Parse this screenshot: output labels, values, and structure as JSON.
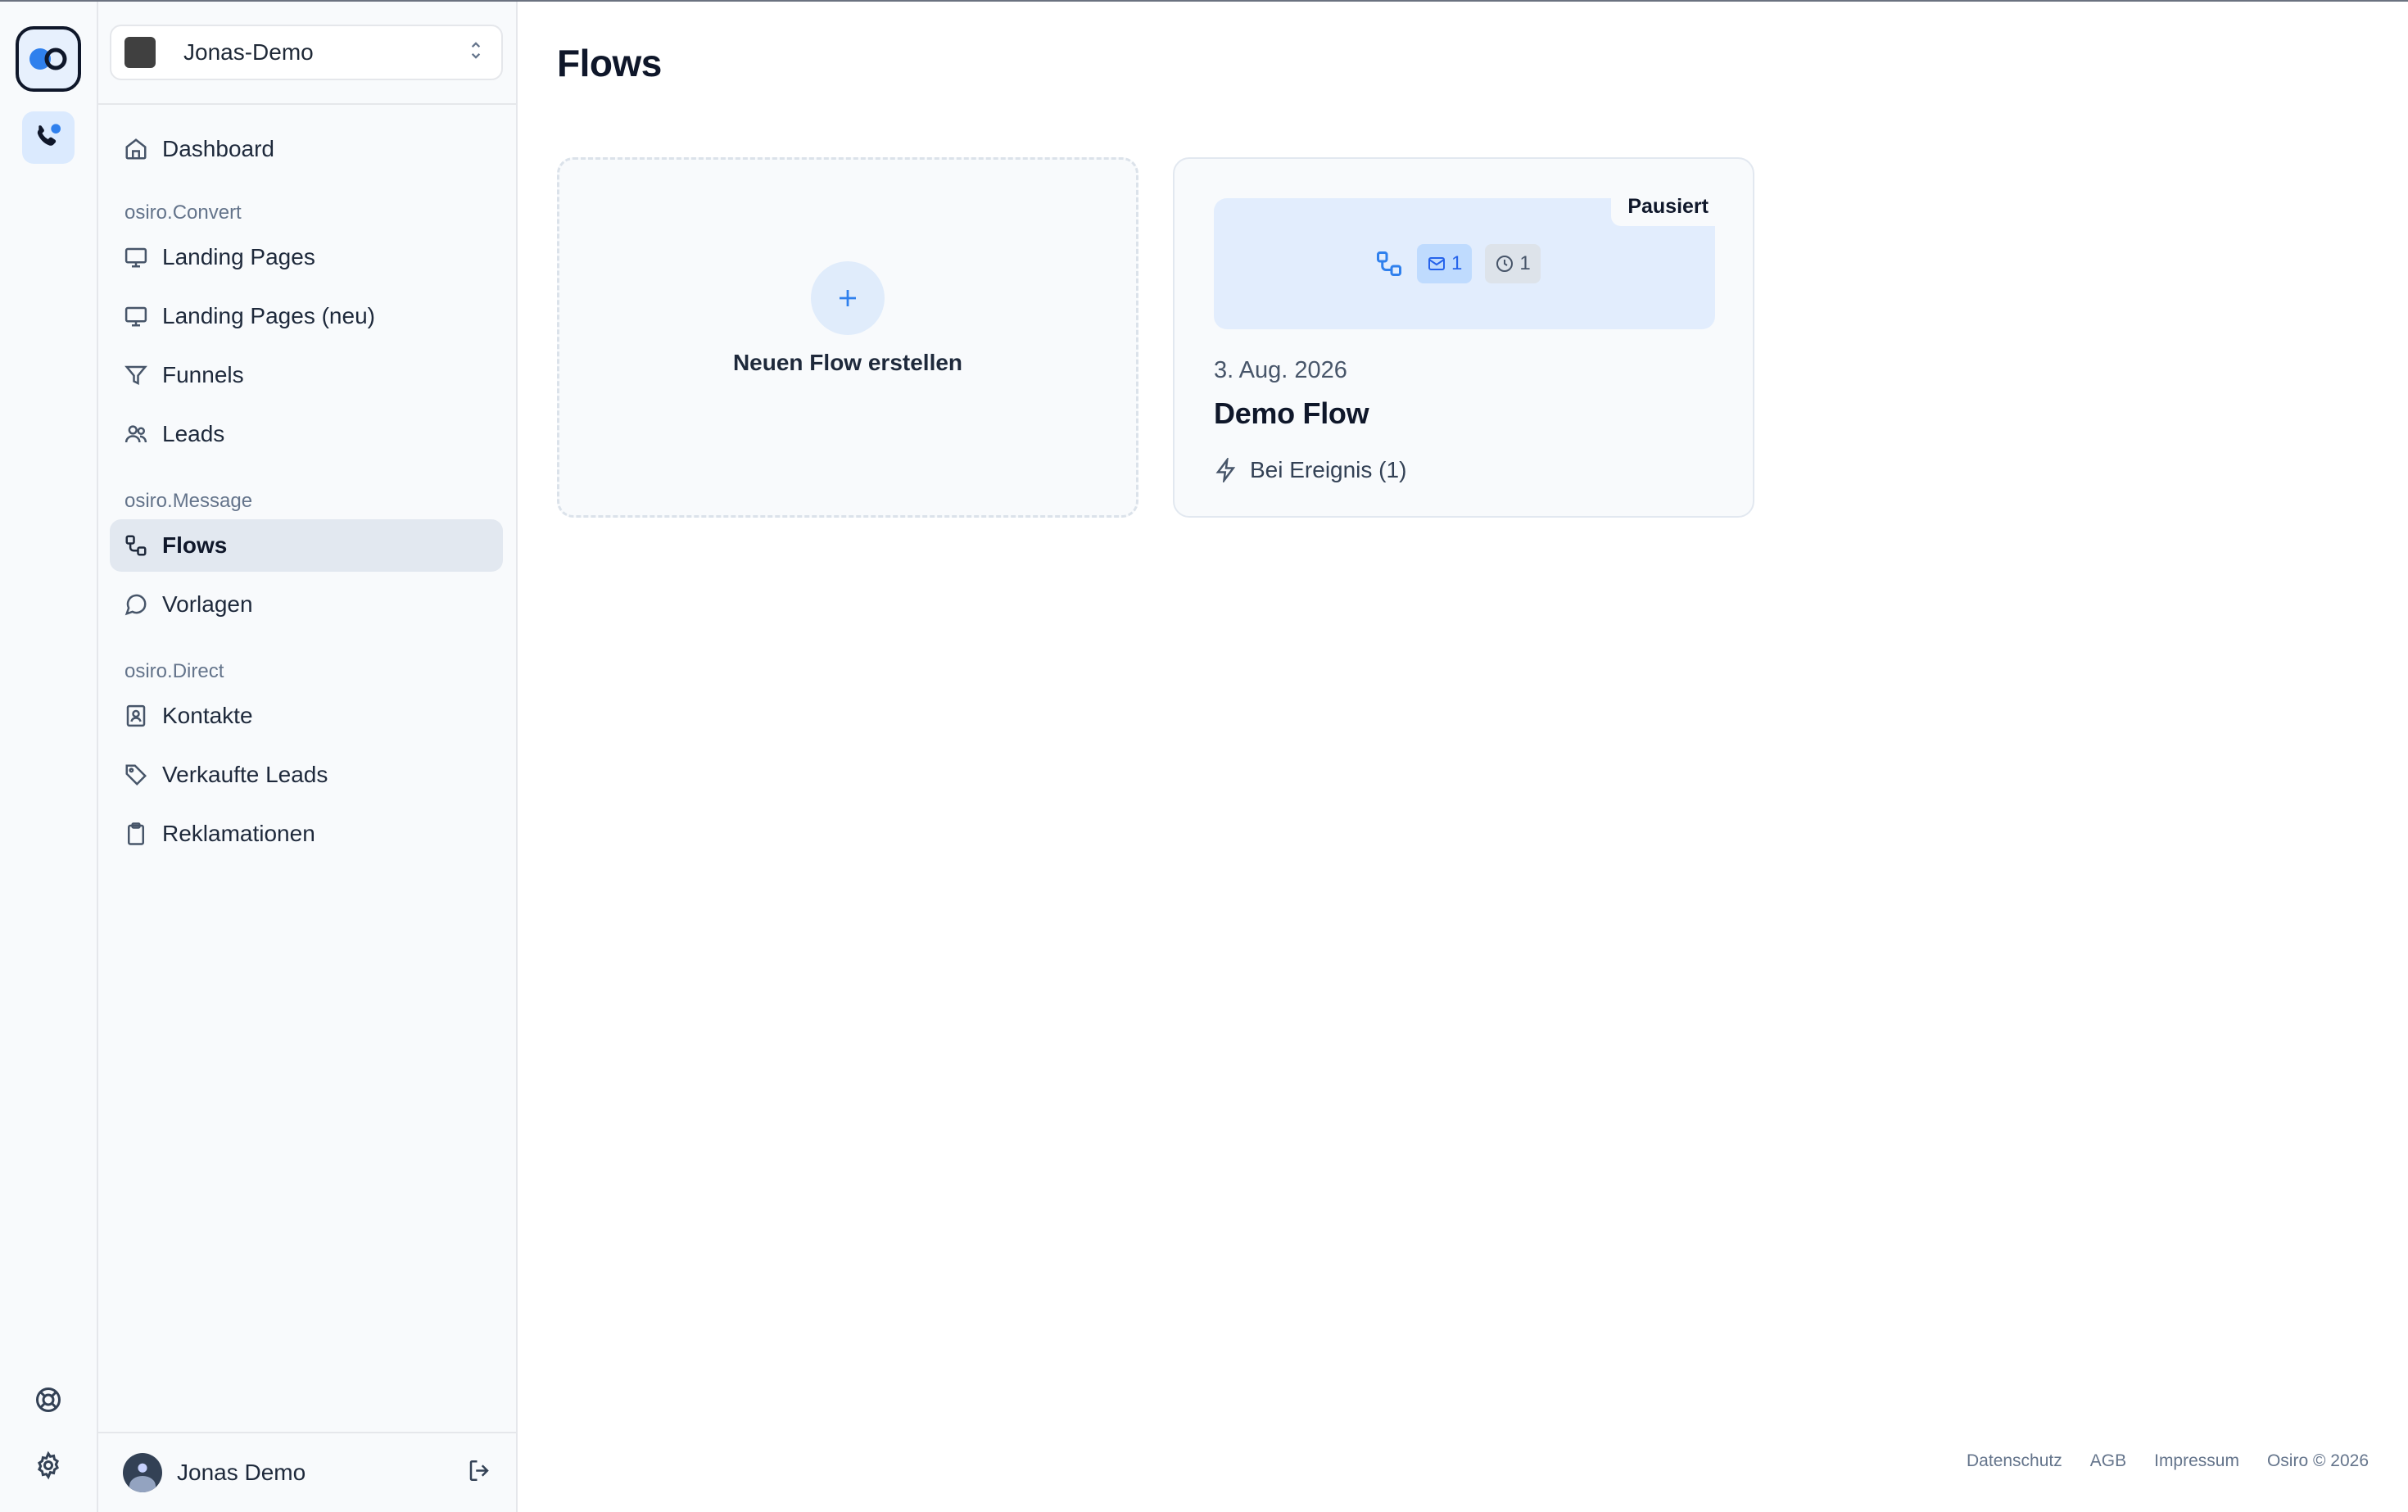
{
  "workspace": {
    "name": "Jonas-Demo"
  },
  "nav": {
    "dashboard": "Dashboard",
    "sections": [
      {
        "label": "osiro.Convert",
        "items": [
          {
            "label": "Landing Pages",
            "icon": "monitor-icon"
          },
          {
            "label": "Landing Pages (neu)",
            "icon": "monitor-icon"
          },
          {
            "label": "Funnels",
            "icon": "filter-icon"
          },
          {
            "label": "Leads",
            "icon": "users-icon"
          }
        ]
      },
      {
        "label": "osiro.Message",
        "items": [
          {
            "label": "Flows",
            "icon": "workflow-icon",
            "active": true
          },
          {
            "label": "Vorlagen",
            "icon": "message-circle-icon"
          }
        ]
      },
      {
        "label": "osiro.Direct",
        "items": [
          {
            "label": "Kontakte",
            "icon": "contact-book-icon"
          },
          {
            "label": "Verkaufte Leads",
            "icon": "tag-icon"
          },
          {
            "label": "Reklamationen",
            "icon": "clipboard-icon"
          }
        ]
      }
    ]
  },
  "user": {
    "name": "Jonas Demo"
  },
  "page": {
    "title": "Flows"
  },
  "new_flow": {
    "label": "Neuen Flow erstellen"
  },
  "flow_card": {
    "status": "Pausiert",
    "mail_count": "1",
    "wait_count": "1",
    "date": "3. Aug. 2026",
    "name": "Demo Flow",
    "trigger": "Bei Ereignis (1)"
  },
  "footer": {
    "links": [
      "Datenschutz",
      "AGB",
      "Impressum"
    ],
    "copyright": "Osiro © 2026"
  },
  "colors": {
    "accent": "#2563eb",
    "active_bg": "#e2e8f0",
    "preview_bg": "#e2edfd"
  }
}
